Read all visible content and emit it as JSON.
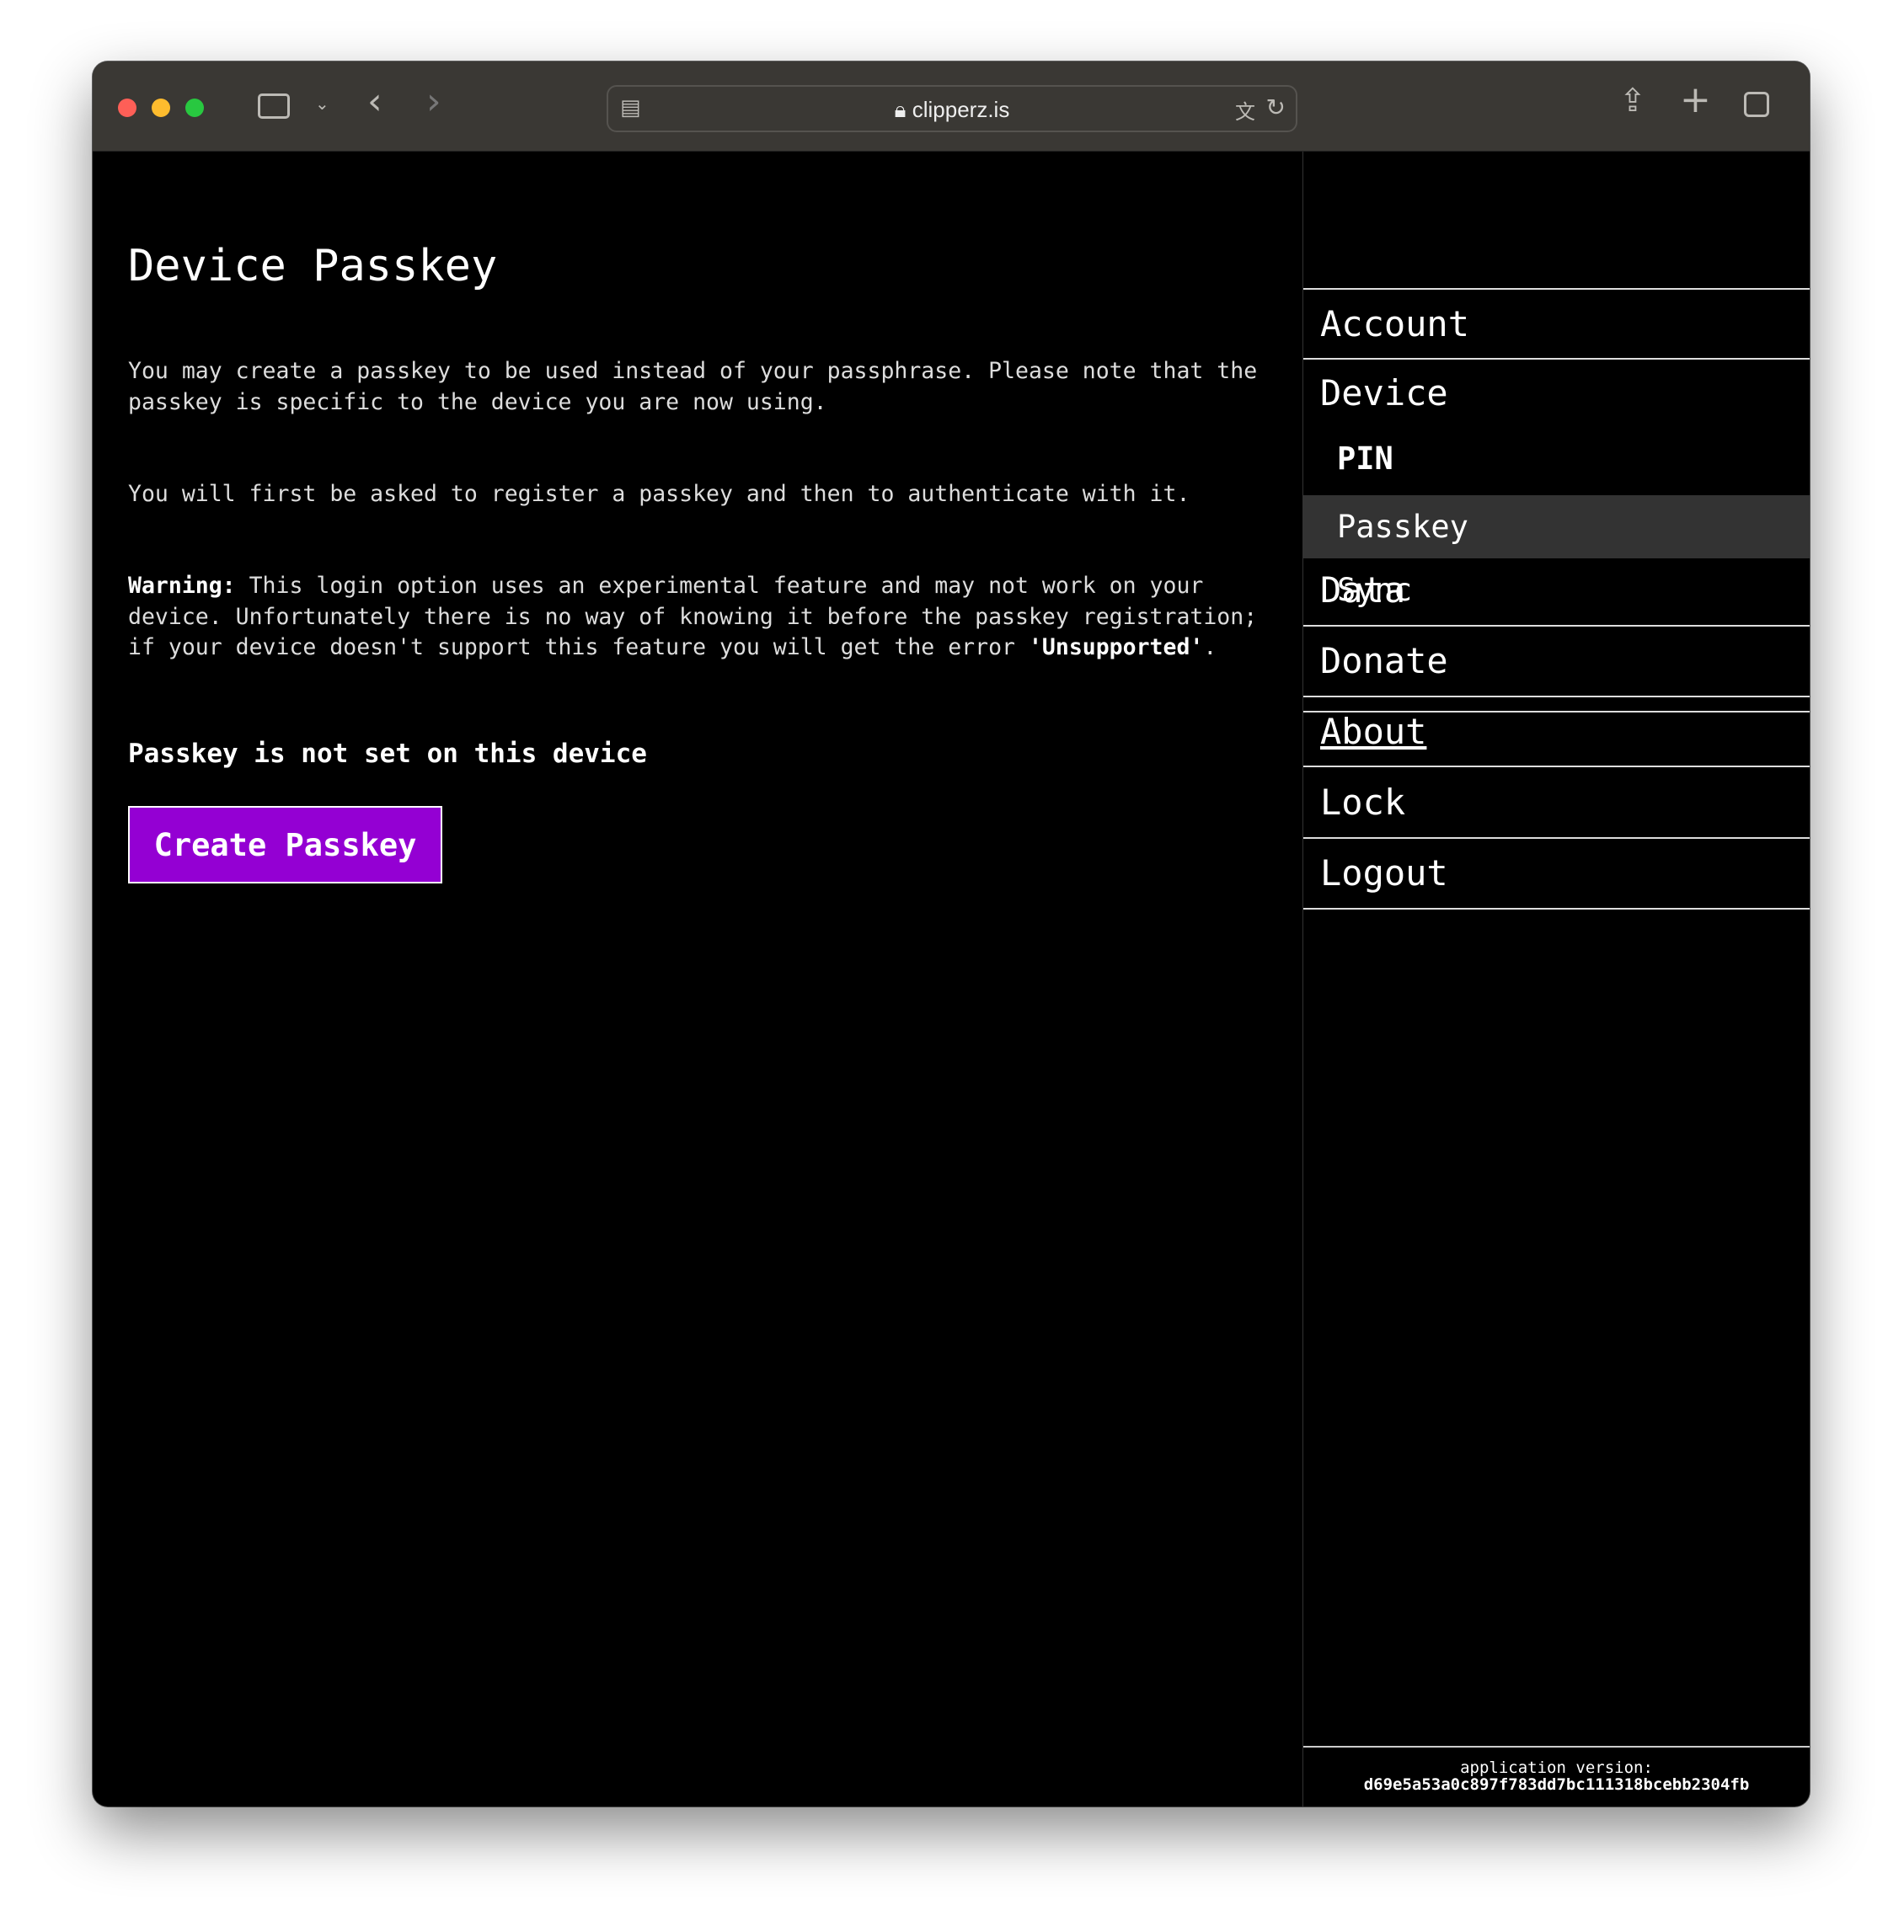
{
  "browser": {
    "url": "clipperz.is",
    "colors": {
      "close": "#fe5f57",
      "minimize": "#febc2e",
      "maximize": "#28c840"
    }
  },
  "main": {
    "title": "Device Passkey",
    "para1": "You may create a passkey to be used instead of your passphrase. Please note that the\npasskey is specific to the device you are now using.",
    "para2": "You will first be asked to register a passkey and then to authenticate with it.",
    "warning_label": "Warning:",
    "warning_text1": " This login option uses an experimental feature and may not work on your\ndevice. Unfortunately there is no way of knowing it before the passkey registration;\nif your device doesn't support this feature you will get the error ",
    "warning_error": "'Unsupported'",
    "warning_end": ".",
    "status": "Passkey is not set on this device",
    "create_button": "Create Passkey",
    "button_color": "#9400d3"
  },
  "sidebar": {
    "items": [
      "Account",
      "Device",
      "Data",
      "Donate",
      "About",
      "Lock",
      "Logout"
    ],
    "device_sub": [
      "PIN",
      "Passkey",
      "Sync"
    ],
    "selected": "Passkey",
    "version_label": "application version:",
    "version": "d69e5a53a0c897f783dd7bc111318bcebb2304fb"
  }
}
